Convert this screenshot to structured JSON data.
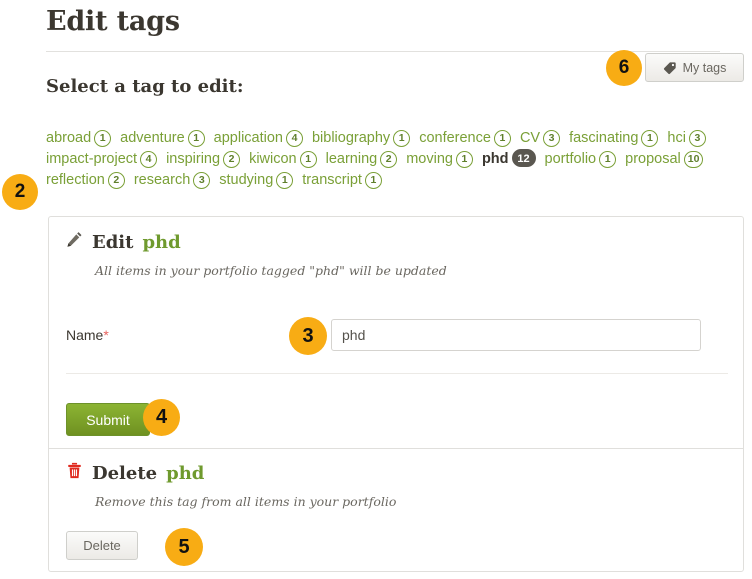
{
  "page": {
    "title": "Edit tags",
    "sub_heading": "Select a tag to edit:"
  },
  "toolbar": {
    "my_tags_label": "My tags",
    "my_tags_icon": "tag-icon"
  },
  "tag_cloud": {
    "tags": [
      {
        "name": "abroad",
        "count": "1",
        "selected": false
      },
      {
        "name": "adventure",
        "count": "1",
        "selected": false
      },
      {
        "name": "application",
        "count": "4",
        "selected": false
      },
      {
        "name": "bibliography",
        "count": "1",
        "selected": false
      },
      {
        "name": "conference",
        "count": "1",
        "selected": false
      },
      {
        "name": "CV",
        "count": "3",
        "selected": false
      },
      {
        "name": "fascinating",
        "count": "1",
        "selected": false
      },
      {
        "name": "hci",
        "count": "3",
        "selected": false
      },
      {
        "name": "impact-project",
        "count": "4",
        "selected": false
      },
      {
        "name": "inspiring",
        "count": "2",
        "selected": false
      },
      {
        "name": "kiwicon",
        "count": "1",
        "selected": false
      },
      {
        "name": "learning",
        "count": "2",
        "selected": false
      },
      {
        "name": "moving",
        "count": "1",
        "selected": false
      },
      {
        "name": "phd",
        "count": "12",
        "selected": true
      },
      {
        "name": "portfolio",
        "count": "1",
        "selected": false
      },
      {
        "name": "proposal",
        "count": "10",
        "selected": false
      },
      {
        "name": "reflection",
        "count": "2",
        "selected": false
      },
      {
        "name": "research",
        "count": "3",
        "selected": false
      },
      {
        "name": "studying",
        "count": "1",
        "selected": false
      },
      {
        "name": "transcript",
        "count": "1",
        "selected": false
      }
    ]
  },
  "edit_section": {
    "icon": "pencil-icon",
    "heading_prefix": "Edit",
    "heading_tag": "phd",
    "description": "All items in your portfolio tagged \"phd\" will be updated",
    "name_label": "Name",
    "required_marker": "*",
    "name_value": "phd",
    "submit_label": "Submit"
  },
  "delete_section": {
    "icon": "trash-icon",
    "heading_prefix": "Delete",
    "heading_tag": "phd",
    "description": "Remove this tag from all items in your portfolio",
    "delete_label": "Delete"
  },
  "callouts": [
    {
      "id": "2",
      "label": "2"
    },
    {
      "id": "3",
      "label": "3"
    },
    {
      "id": "4",
      "label": "4"
    },
    {
      "id": "5",
      "label": "5"
    },
    {
      "id": "6",
      "label": "6"
    }
  ],
  "colors": {
    "tag_green": "#7aa037",
    "heading_tag_green": "#6f9a2e",
    "callout_orange": "#f8ac14",
    "submit_green": "#7da32a",
    "trash_red": "#e02b20",
    "required_red": "#e8635e",
    "selected_badge": "#5a5750"
  }
}
